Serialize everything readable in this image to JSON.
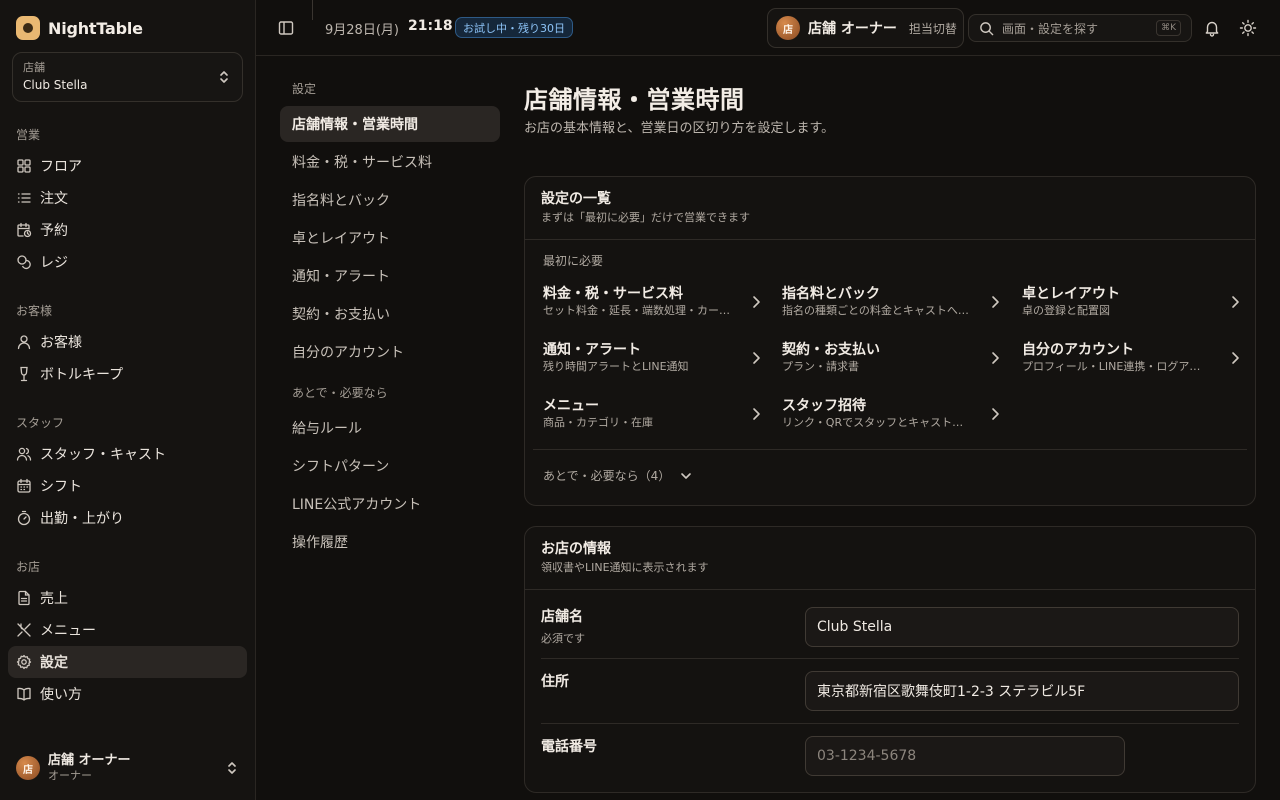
{
  "brand": {
    "name": "NightTable"
  },
  "store": {
    "label": "店舗",
    "value": "Club Stella"
  },
  "sidebar": {
    "groups": [
      {
        "title": "営業",
        "items": [
          {
            "label": "フロア",
            "icon": "grid-icon"
          },
          {
            "label": "注文",
            "icon": "list-icon"
          },
          {
            "label": "予約",
            "icon": "calendar-clock-icon"
          },
          {
            "label": "レジ",
            "icon": "coins-icon"
          }
        ]
      },
      {
        "title": "お客様",
        "items": [
          {
            "label": "お客様",
            "icon": "user-icon"
          },
          {
            "label": "ボトルキープ",
            "icon": "wine-icon"
          }
        ]
      },
      {
        "title": "スタッフ",
        "items": [
          {
            "label": "スタッフ・キャスト",
            "icon": "users-icon"
          },
          {
            "label": "シフト",
            "icon": "calendar-icon"
          },
          {
            "label": "出勤・上がり",
            "icon": "timer-icon"
          }
        ]
      },
      {
        "title": "お店",
        "items": [
          {
            "label": "売上",
            "icon": "document-icon"
          },
          {
            "label": "メニュー",
            "icon": "utensils-icon"
          },
          {
            "label": "設定",
            "icon": "gear-icon",
            "active": true
          },
          {
            "label": "使い方",
            "icon": "book-icon"
          }
        ]
      }
    ]
  },
  "user": {
    "avatar": "店",
    "name": "店舗 オーナー",
    "role": "オーナー"
  },
  "topbar": {
    "date": "9月28日(月)",
    "time": "21:18",
    "trial_badge": "お試し中・残り30日",
    "owner_avatar": "店",
    "owner_name": "店舗 オーナー",
    "switch_label": "担当切替",
    "search_placeholder": "画面・設定を探す",
    "search_shortcut": "⌘K"
  },
  "subnav": {
    "title_primary": "設定",
    "primary": [
      "店舗情報・営業時間",
      "料金・税・サービス料",
      "指名料とバック",
      "卓とレイアウト",
      "通知・アラート",
      "契約・お支払い",
      "自分のアカウント"
    ],
    "title_secondary": "あとで・必要なら",
    "secondary": [
      "給与ルール",
      "シフトパターン",
      "LINE公式アカウント",
      "操作履歴"
    ]
  },
  "page": {
    "title": "店舗情報・営業時間",
    "subtitle": "お店の基本情報と、営業日の区切り方を設定します。"
  },
  "overview": {
    "title": "設定の一覧",
    "desc": "まずは「最初に必要」だけで営業できます",
    "section": "最初に必要",
    "items": [
      {
        "title": "料金・税・サービス料",
        "desc": "セット料金・延長・端数処理・カード手数料"
      },
      {
        "title": "指名料とバック",
        "desc": "指名の種類ごとの料金とキャストへのバック"
      },
      {
        "title": "卓とレイアウト",
        "desc": "卓の登録と配置図"
      },
      {
        "title": "通知・アラート",
        "desc": "残り時間アラートとLINE通知"
      },
      {
        "title": "契約・お支払い",
        "desc": "プラン・請求書"
      },
      {
        "title": "自分のアカウント",
        "desc": "プロフィール・LINE連携・ログアウト"
      },
      {
        "title": "メニュー",
        "desc": "商品・カテゴリ・在庫"
      },
      {
        "title": "スタッフ招待",
        "desc": "リンク・QRでスタッフとキャストを招待"
      }
    ],
    "later": "あとで・必要なら（4）"
  },
  "store_info": {
    "title": "お店の情報",
    "desc": "領収書やLINE通知に表示されます",
    "fields": [
      {
        "label": "店舗名",
        "hint": "必須です",
        "value": "Club Stella",
        "placeholder": ""
      },
      {
        "label": "住所",
        "hint": "",
        "value": "東京都新宿区歌舞伎町1-2-3 ステラビル5F",
        "placeholder": ""
      },
      {
        "label": "電話番号",
        "hint": "",
        "value": "",
        "placeholder": "03-1234-5678"
      }
    ]
  }
}
